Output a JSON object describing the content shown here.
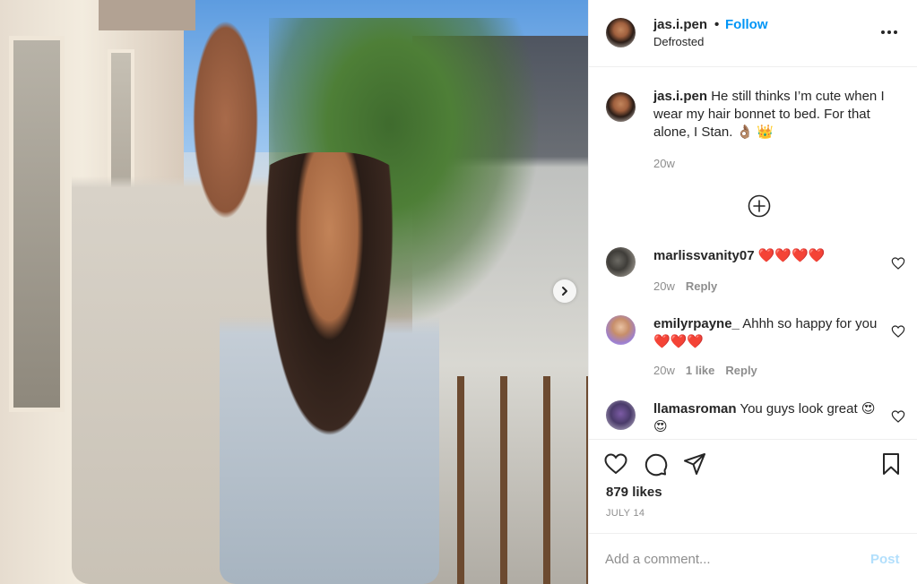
{
  "header": {
    "username": "jas.i.pen",
    "separator": "•",
    "follow_label": "Follow",
    "location": "Defrosted",
    "more_icon": "more-horizontal-icon"
  },
  "caption": {
    "username": "jas.i.pen",
    "text": "He still thinks I’m cute when I wear my hair bonnet to bed. For that alone, I Stan. 👌🏽 👑",
    "time": "20w"
  },
  "load_more_icon": "plus-circle-icon",
  "comments": [
    {
      "username": "marlissvanity07",
      "text": "❤️❤️❤️❤️",
      "time": "20w",
      "likes": "",
      "reply_label": "Reply"
    },
    {
      "username": "emilyrpayne_",
      "text": "Ahhh so happy for you❤️❤️❤️",
      "time": "20w",
      "likes": "1 like",
      "reply_label": "Reply"
    },
    {
      "username": "llamasroman",
      "text": "You guys look great 😍😍",
      "time": "",
      "likes": "",
      "reply_label": ""
    }
  ],
  "actions": {
    "likes_count": "879 likes",
    "date": "JULY 14"
  },
  "add_comment": {
    "placeholder": "Add a comment...",
    "post_label": "Post"
  },
  "colors": {
    "accent": "#0095f6",
    "post_disabled": "#b2dffc",
    "text": "#262626",
    "secondary": "#8e8e8e"
  }
}
